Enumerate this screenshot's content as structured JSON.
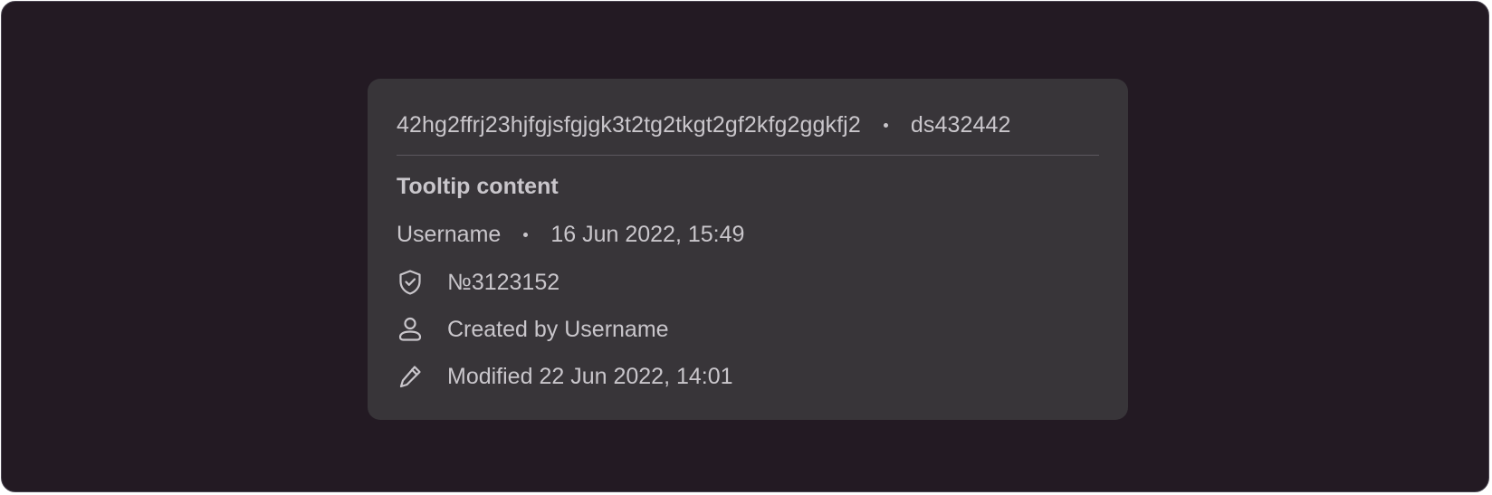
{
  "tooltip": {
    "hash": "42hg2ffrj23hjfgjsfgjgk3t2tg2tkgt2gf2kfg2ggkfj2",
    "code": "ds432442",
    "title": "Tooltip content",
    "author": "Username",
    "date": "16 Jun 2022, 15:49",
    "items": [
      {
        "icon": "shield-check-icon",
        "text": "№3123152"
      },
      {
        "icon": "user-icon",
        "text": "Created by Username"
      },
      {
        "icon": "pencil-icon",
        "text": "Modified 22 Jun 2022, 14:01"
      }
    ]
  },
  "colors": {
    "page_background": "#231a23",
    "tooltip_background": "#383539",
    "text": "#c9c6cb",
    "divider": "#5c585e"
  }
}
